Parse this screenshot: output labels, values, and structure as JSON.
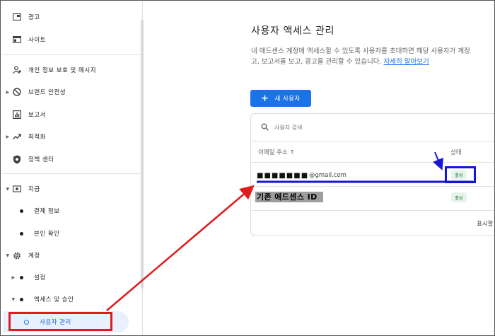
{
  "sidebar": {
    "items": [
      {
        "label": "광고",
        "icon": "ad-icon"
      },
      {
        "label": "사이트",
        "icon": "site-icon"
      },
      {
        "label": "개인 정보 보호 및 메시지",
        "icon": "privacy-icon"
      },
      {
        "label": "브랜드 안전성",
        "icon": "block-icon"
      },
      {
        "label": "보고서",
        "icon": "report-icon"
      },
      {
        "label": "최적화",
        "icon": "trending-icon"
      },
      {
        "label": "정책 센터",
        "icon": "policy-shield-icon"
      },
      {
        "label": "지급",
        "icon": "payment-icon"
      },
      {
        "label": "결제 정보"
      },
      {
        "label": "본인 확인"
      },
      {
        "label": "계정",
        "icon": "gear-icon"
      },
      {
        "label": "설정"
      },
      {
        "label": "액세스 및 승인"
      },
      {
        "label": "사용자 관리"
      }
    ]
  },
  "main": {
    "title": "사용자 액세스 관리",
    "desc_line1": "내 애드센스 계정에 액세스할 수 있도록 사용자를 초대하면 해당 사용자가 계정",
    "desc_line2": "고, 보고서를 보고, 광고를 관리할 수 있습니다. ",
    "learn_more": "자세히 알아보기",
    "new_user_btn": "새 사용자",
    "search_placeholder": "사용자 검색",
    "col_email": "이메일 주소 ↑",
    "col_status": "상태",
    "rows": [
      {
        "masked": "■■■■■■■",
        "email": "@gmail.com",
        "status": "활성"
      },
      {
        "label": "기존 애드센스 ID",
        "status": "활성"
      }
    ],
    "pager": "표시할 행"
  },
  "colors": {
    "accent": "#1a73e8",
    "annotation_red": "#e01b1b",
    "annotation_blue": "#1515d6",
    "active_bg": "#e8f0fe",
    "status_green": "#137333"
  }
}
